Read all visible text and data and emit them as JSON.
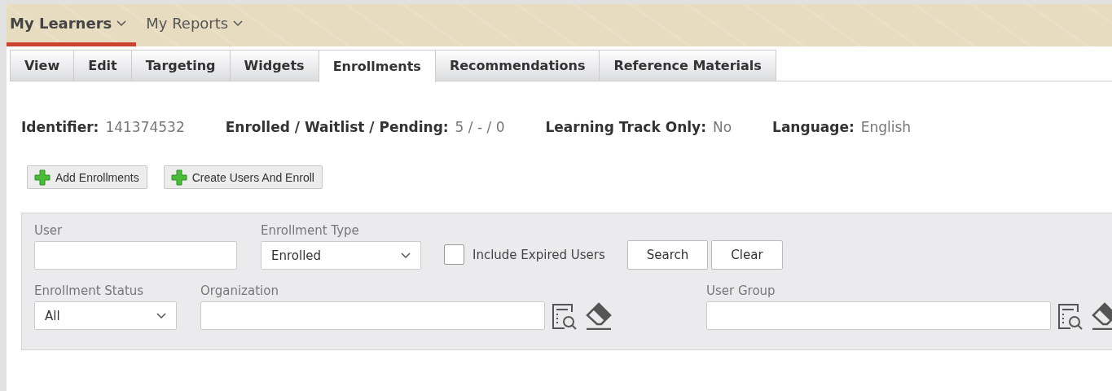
{
  "nav": [
    {
      "label": "My Learners",
      "selected": true
    },
    {
      "label": "My Reports",
      "selected": false
    }
  ],
  "tabs": [
    {
      "label": "View",
      "selected": false
    },
    {
      "label": "Edit",
      "selected": false
    },
    {
      "label": "Targeting",
      "selected": false
    },
    {
      "label": "Widgets",
      "selected": false
    },
    {
      "label": "Enrollments",
      "selected": true
    },
    {
      "label": "Recommendations",
      "selected": false
    },
    {
      "label": "Reference Materials",
      "selected": false
    }
  ],
  "details": [
    {
      "label": "Identifier:",
      "value": "141374532"
    },
    {
      "label": "Enrolled / Waitlist / Pending:",
      "value": "5 / - / 0"
    },
    {
      "label": "Learning Track Only:",
      "value": "No"
    },
    {
      "label": "Language:",
      "value": "English"
    }
  ],
  "actions": [
    "Add Enrollments",
    "Create Users And Enroll"
  ],
  "filters": {
    "user": {
      "label": "User"
    },
    "enrollment_type": {
      "label": "Enrollment Type",
      "value": "Enrolled"
    },
    "include_expired": {
      "label": "Include Expired Users",
      "checked": false
    },
    "buttons": [
      "Search",
      "Clear"
    ],
    "enrollment_status": {
      "label": "Enrollment Status",
      "value": "All"
    },
    "organization": {
      "label": "Organization"
    },
    "user_group": {
      "label": "User Group"
    }
  }
}
